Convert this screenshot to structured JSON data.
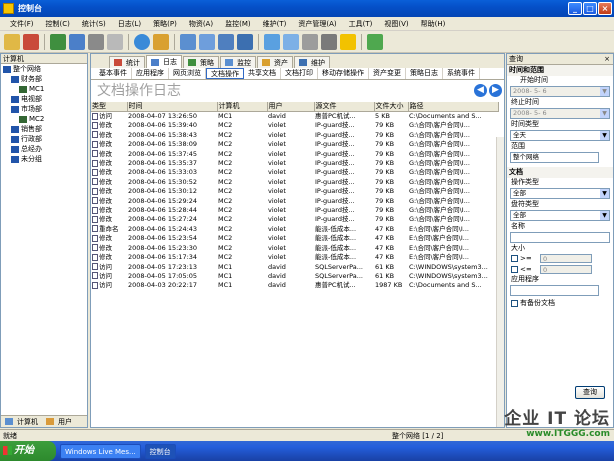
{
  "window": {
    "title": "控制台"
  },
  "menu": [
    "文件(F)",
    "控制(C)",
    "统计(S)",
    "日志(L)",
    "策略(P)",
    "物资(A)",
    "监控(M)",
    "维护(T)",
    "资产管理(A)",
    "工具(T)",
    "视图(V)",
    "帮助(H)"
  ],
  "left_panel": {
    "header": "计算机",
    "tree": [
      {
        "label": "整个网络",
        "level": 0,
        "color": "#2255aa"
      },
      {
        "label": "财务部",
        "level": 1,
        "color": "#2255aa"
      },
      {
        "label": "MC1",
        "level": 2,
        "color": "#336633"
      },
      {
        "label": "电视部",
        "level": 1,
        "color": "#2255aa"
      },
      {
        "label": "市场部",
        "level": 1,
        "color": "#2255aa"
      },
      {
        "label": "MC2",
        "level": 2,
        "color": "#336633"
      },
      {
        "label": "销售部",
        "level": 1,
        "color": "#2255aa"
      },
      {
        "label": "行政部",
        "level": 1,
        "color": "#2255aa"
      },
      {
        "label": "总经办",
        "level": 1,
        "color": "#2255aa"
      },
      {
        "label": "未分组",
        "level": 1,
        "color": "#2255aa"
      }
    ],
    "footer_tabs": [
      "计算机",
      "用户"
    ]
  },
  "center": {
    "top_tabs": [
      "统计",
      "日志",
      "策略",
      "监控",
      "资产",
      "维护"
    ],
    "active_top_tab": 1,
    "sub_tabs": [
      "基本事件",
      "应用程序",
      "网页浏览",
      "文档操作",
      "共享文档",
      "文档打印",
      "移动存储操作",
      "资产变更",
      "策略日志",
      "系统事件"
    ],
    "active_sub_tab": 3,
    "title": "文档操作日志",
    "columns": [
      "类型",
      "时间",
      "计算机",
      "用户",
      "源文件",
      "文件大小",
      "路径"
    ],
    "rows": [
      [
        "访问",
        "2008-04-07 13:26:50",
        "MC1",
        "david",
        "惠普PC机试...",
        "5 KB",
        "C:\\Documents and S..."
      ],
      [
        "修改",
        "2008-04-06 15:39:40",
        "MC2",
        "violet",
        "IP-guard技...",
        "79 KB",
        "G:\\合同\\客户合同\\I..."
      ],
      [
        "修改",
        "2008-04-06 15:38:43",
        "MC2",
        "violet",
        "IP-guard技...",
        "79 KB",
        "G:\\合同\\客户合同\\I..."
      ],
      [
        "修改",
        "2008-04-06 15:38:09",
        "MC2",
        "violet",
        "IP-guard技...",
        "79 KB",
        "G:\\合同\\客户合同\\I..."
      ],
      [
        "修改",
        "2008-04-06 15:37:45",
        "MC2",
        "violet",
        "IP-guard技...",
        "79 KB",
        "G:\\合同\\客户合同\\I..."
      ],
      [
        "修改",
        "2008-04-06 15:35:37",
        "MC2",
        "violet",
        "IP-guard技...",
        "79 KB",
        "G:\\合同\\客户合同\\I..."
      ],
      [
        "修改",
        "2008-04-06 15:33:03",
        "MC2",
        "violet",
        "IP-guard技...",
        "79 KB",
        "G:\\合同\\客户合同\\I..."
      ],
      [
        "修改",
        "2008-04-06 15:30:52",
        "MC2",
        "violet",
        "IP-guard技...",
        "79 KB",
        "G:\\合同\\客户合同\\I..."
      ],
      [
        "修改",
        "2008-04-06 15:30:12",
        "MC2",
        "violet",
        "IP-guard技...",
        "79 KB",
        "G:\\合同\\客户合同\\I..."
      ],
      [
        "修改",
        "2008-04-06 15:29:24",
        "MC2",
        "violet",
        "IP-guard技...",
        "79 KB",
        "G:\\合同\\客户合同\\I..."
      ],
      [
        "修改",
        "2008-04-06 15:28:44",
        "MC2",
        "violet",
        "IP-guard技...",
        "79 KB",
        "G:\\合同\\客户合同\\I..."
      ],
      [
        "修改",
        "2008-04-06 15:27:24",
        "MC2",
        "violet",
        "IP-guard技...",
        "79 KB",
        "G:\\合同\\客户合同\\I..."
      ],
      [
        "重命名",
        "2008-04-06 15:24:43",
        "MC2",
        "violet",
        "能派-低成本...",
        "47 KB",
        "E:\\合同\\客户合同\\I..."
      ],
      [
        "修改",
        "2008-04-06 15:23:54",
        "MC2",
        "violet",
        "能派-低成本...",
        "47 KB",
        "E:\\合同\\客户合同\\I..."
      ],
      [
        "修改",
        "2008-04-06 15:23:30",
        "MC2",
        "violet",
        "能派-低成本...",
        "47 KB",
        "E:\\合同\\客户合同\\I..."
      ],
      [
        "修改",
        "2008-04-06 15:17:34",
        "MC2",
        "violet",
        "能派-低成本...",
        "47 KB",
        "E:\\合同\\客户合同\\I..."
      ],
      [
        "访问",
        "2008-04-05 17:23:13",
        "MC1",
        "david",
        "SQLServerPa...",
        "61 KB",
        "C:\\WINDOWS\\system3..."
      ],
      [
        "访问",
        "2008-04-05 17:05:05",
        "MC1",
        "david",
        "SQLServerPa...",
        "61 KB",
        "C:\\WINDOWS\\system3..."
      ],
      [
        "访问",
        "2008-04-03 20:22:17",
        "MC1",
        "david",
        "惠普PC机试...",
        "1987 KB",
        "C:\\Documents and S..."
      ]
    ]
  },
  "right_panel": {
    "header": "查询",
    "section_time": "时间和范围",
    "start_time_label": "开始时间",
    "start_time_value": "2008- 5- 6",
    "end_time_label": "终止时间",
    "end_time_value": "2008- 5- 6",
    "time_type_label": "时间类型",
    "time_type_value": "全天",
    "scope_label": "范围",
    "scope_value": "整个网络",
    "section_doc": "文档",
    "op_type_label": "操作类型",
    "op_type_value": "全部",
    "storage_type_label": "盘符类型",
    "storage_type_value": "全部",
    "name_label": "名称",
    "size_label": "大小",
    "size_ge": ">=",
    "size_le": "<=",
    "size_ge_value": "0",
    "size_le_value": "0",
    "app_label": "应用程序",
    "backup_label": "有备份文档",
    "query_button": "查询"
  },
  "statusbar": {
    "left": "就绪",
    "page": "整个网络 [1 / 2]"
  },
  "taskbar": {
    "start": "开始",
    "tasks": [
      "Windows Live Mes...",
      "控制台"
    ]
  },
  "watermark": {
    "line1": "企业 IT 论坛",
    "line2": "www.ITGGG.com"
  },
  "colors": {
    "accent": "#0a5fd8",
    "taskbar": "#245edb"
  }
}
